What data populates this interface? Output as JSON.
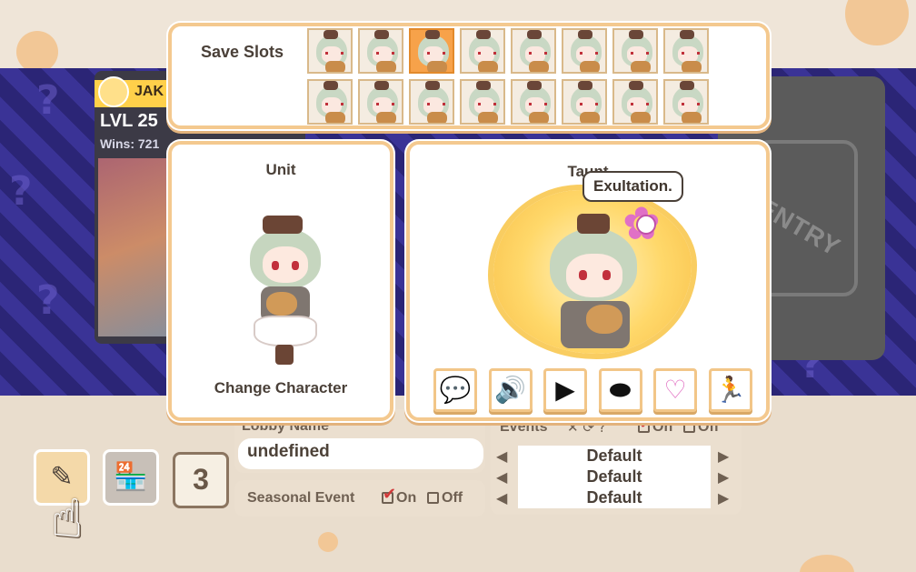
{
  "save_slots": {
    "title": "Save Slots",
    "rows": [
      [
        "slot",
        "slot",
        "slot",
        "slot",
        "slot",
        "slot",
        "slot",
        "slot"
      ],
      [
        "slot",
        "slot",
        "slot",
        "slot",
        "slot",
        "slot",
        "slot",
        "slot"
      ]
    ],
    "selected_index": 2
  },
  "unit": {
    "title": "Unit",
    "change_label": "Change Character"
  },
  "taunt": {
    "title": "Taunt",
    "speech": "Exultation.",
    "buttons": [
      {
        "icon": "speech-bubble-icon",
        "glyph": "💬"
      },
      {
        "icon": "speaker-icon",
        "glyph": "🔊"
      },
      {
        "icon": "play-icon",
        "glyph": "▶"
      },
      {
        "icon": "oval-icon",
        "glyph": "⬬"
      },
      {
        "icon": "heart-balloon-icon",
        "glyph": "♡"
      },
      {
        "icon": "pose-figure-icon",
        "glyph": "🏃"
      }
    ]
  },
  "background": {
    "player": {
      "name": "JAK",
      "level": "LVL 25",
      "wins": "Wins: 721"
    },
    "entry_text": "ENTRY",
    "tools": {
      "counter": "3"
    },
    "lobby": {
      "label": "Lobby Name",
      "value": "undefined"
    },
    "seasonal": {
      "label": "Seasonal Event",
      "on_label": "On",
      "off_label": "Off"
    },
    "events": {
      "label": "Events",
      "on_label": "On",
      "off_label": "Off",
      "rows": [
        "Default",
        "Default",
        "Default"
      ]
    }
  },
  "colors": {
    "panel_border": "#f4c98f",
    "selected_slot": "#f7a24a",
    "stage_purple": "#3a3396",
    "heart_pink": "#e06ac0"
  }
}
